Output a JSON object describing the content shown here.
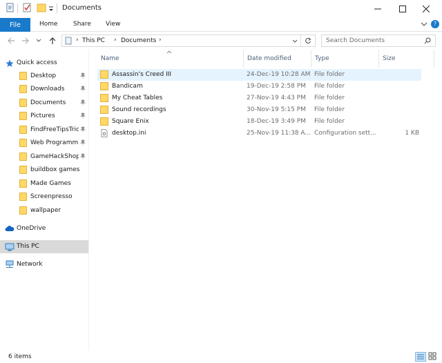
{
  "window": {
    "title": "Documents",
    "controls": [
      "minimize",
      "maximize",
      "close"
    ]
  },
  "ribbon": {
    "file_tab": "File",
    "tabs": [
      "Home",
      "Share",
      "View"
    ]
  },
  "address": {
    "breadcrumb": [
      "This PC",
      "Documents"
    ],
    "search_placeholder": "Search Documents"
  },
  "sidebar": {
    "items": [
      {
        "label": "Quick access",
        "icon": "star-icon"
      },
      {
        "label": "Desktop",
        "icon": "folder-icon",
        "pinned": true
      },
      {
        "label": "Downloads",
        "icon": "folder-icon",
        "pinned": true
      },
      {
        "label": "Documents",
        "icon": "folder-icon",
        "pinned": true
      },
      {
        "label": "Pictures",
        "icon": "folder-icon",
        "pinned": true
      },
      {
        "label": "FindFreeTipsTric",
        "icon": "folder-icon",
        "pinned": true
      },
      {
        "label": "Web Programmi",
        "icon": "folder-icon",
        "pinned": true
      },
      {
        "label": "GameHackShop",
        "icon": "folder-icon",
        "pinned": true
      },
      {
        "label": "buildbox games",
        "icon": "folder-icon",
        "pinned": false
      },
      {
        "label": "Made Games",
        "icon": "folder-icon",
        "pinned": false
      },
      {
        "label": "Screenpresso",
        "icon": "folder-icon",
        "pinned": false
      },
      {
        "label": "wallpaper",
        "icon": "folder-icon",
        "pinned": false
      },
      {
        "label": "OneDrive",
        "icon": "cloud-icon"
      },
      {
        "label": "This PC",
        "icon": "computer-icon",
        "selected": true
      },
      {
        "label": "Network",
        "icon": "network-icon"
      }
    ]
  },
  "columns": [
    "Name",
    "Date modified",
    "Type",
    "Size"
  ],
  "files": [
    {
      "name": "Assassin's Creed III",
      "date": "24-Dec-19 10:28 AM",
      "type": "File folder",
      "size": "",
      "icon": "folder-icon",
      "selected": true
    },
    {
      "name": "Bandicam",
      "date": "19-Dec-19 2:58 PM",
      "type": "File folder",
      "size": "",
      "icon": "folder-icon"
    },
    {
      "name": "My Cheat Tables",
      "date": "27-Nov-19 4:43 PM",
      "type": "File folder",
      "size": "",
      "icon": "folder-icon"
    },
    {
      "name": "Sound recordings",
      "date": "30-Nov-19 5:15 PM",
      "type": "File folder",
      "size": "",
      "icon": "folder-icon"
    },
    {
      "name": "Square Enix",
      "date": "18-Dec-19 3:49 PM",
      "type": "File folder",
      "size": "",
      "icon": "folder-icon"
    },
    {
      "name": "desktop.ini",
      "date": "25-Nov-19 11:38 A...",
      "type": "Configuration sett...",
      "size": "1 KB",
      "icon": "settings-file-icon"
    }
  ],
  "status": {
    "item_count": "6 items"
  },
  "colors": {
    "accent": "#1979ca",
    "folder": "#ffd866",
    "selected_row": "#e5f3ff",
    "selected_nav": "#d9d9d9"
  }
}
